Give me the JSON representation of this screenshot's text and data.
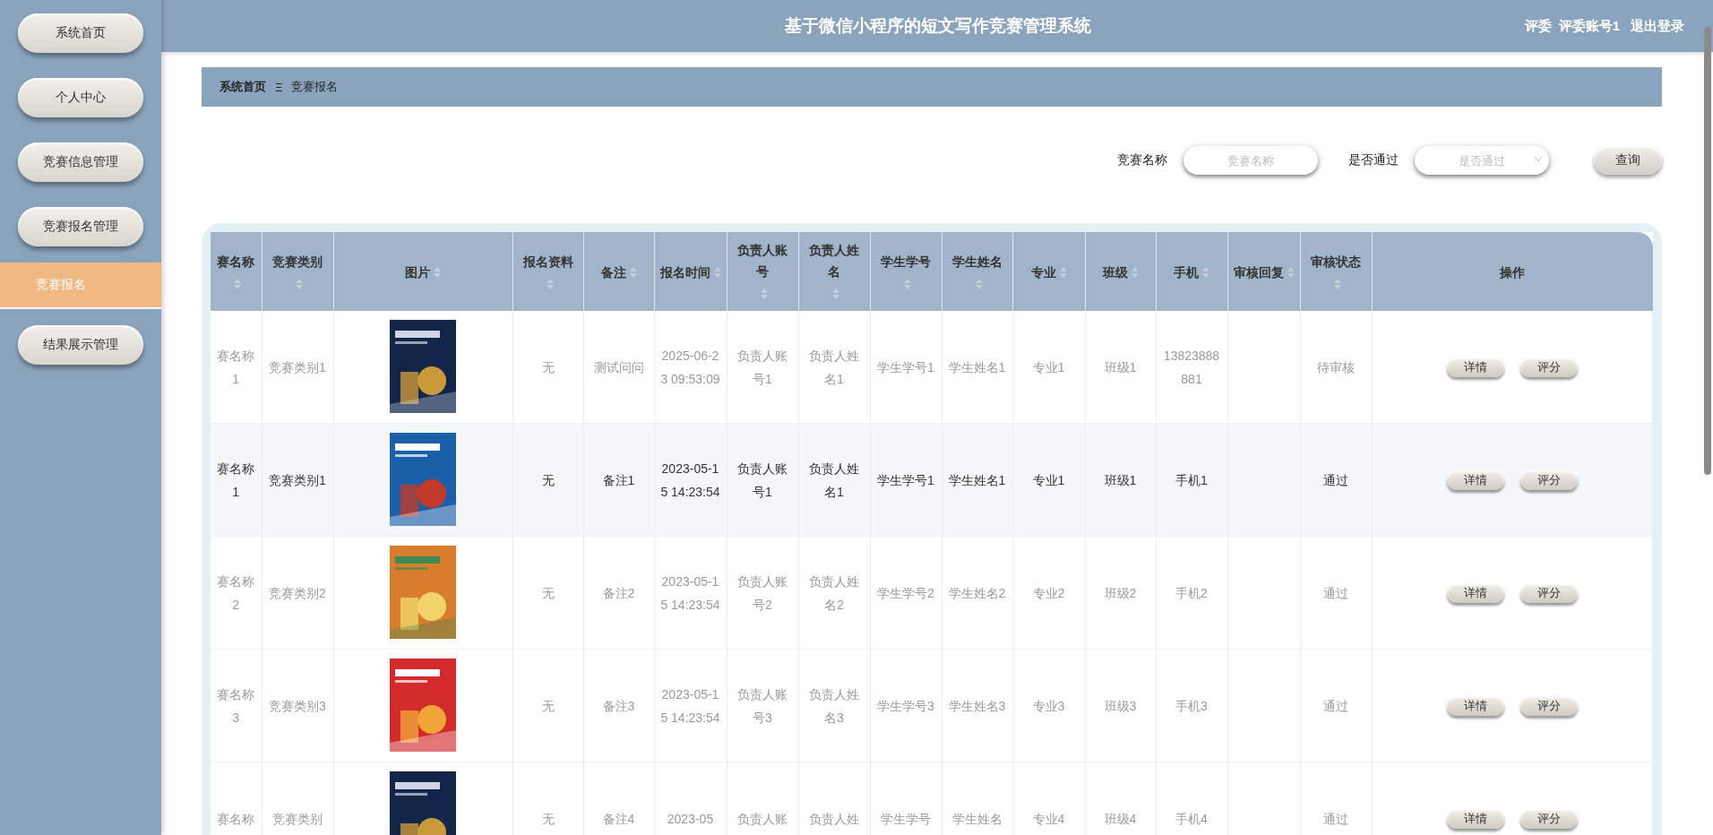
{
  "header": {
    "title": "基于微信小程序的短文写作竞赛管理系统",
    "user_role": "评委",
    "user_name": "评委账号1",
    "logout": "退出登录"
  },
  "sidebar": {
    "items": [
      {
        "label": "系统首页",
        "kind": "button",
        "selected": false
      },
      {
        "label": "个人中心",
        "kind": "button",
        "selected": false
      },
      {
        "label": "竞赛信息管理",
        "kind": "button",
        "selected": false
      },
      {
        "label": "竞赛报名管理",
        "kind": "button",
        "selected": false
      },
      {
        "label": "竞赛报名",
        "kind": "subitem",
        "selected": true
      },
      {
        "label": "结果展示管理",
        "kind": "button",
        "selected": false
      }
    ]
  },
  "breadcrumb": {
    "home": "系统首页",
    "separator": "Ξ",
    "current": "竞赛报名"
  },
  "search": {
    "fields": [
      {
        "label": "竞赛名称",
        "placeholder": "竞赛名称",
        "kind": "input"
      },
      {
        "label": "是否通过",
        "placeholder": "是否通过",
        "kind": "select"
      }
    ],
    "button": "查询"
  },
  "table": {
    "columns": [
      {
        "label": "赛名称",
        "sortable": true
      },
      {
        "label": "竞赛类别",
        "sortable": true
      },
      {
        "label": "图片",
        "sortable": true
      },
      {
        "label": "报名资料",
        "sortable": true
      },
      {
        "label": "备注",
        "sortable": true
      },
      {
        "label": "报名时间",
        "sortable": true
      },
      {
        "label": "负责人账号",
        "sortable": true
      },
      {
        "label": "负责人姓名",
        "sortable": true
      },
      {
        "label": "学生学号",
        "sortable": true
      },
      {
        "label": "学生姓名",
        "sortable": true
      },
      {
        "label": "专业",
        "sortable": true
      },
      {
        "label": "班级",
        "sortable": true
      },
      {
        "label": "手机",
        "sortable": true
      },
      {
        "label": "审核回复",
        "sortable": true
      },
      {
        "label": "审核状态",
        "sortable": true
      },
      {
        "label": "操作",
        "sortable": false
      }
    ],
    "rows": [
      {
        "highlighted": false,
        "cells": [
          {
            "kind": "text",
            "text": "赛名称1"
          },
          {
            "kind": "text",
            "text": "竞赛类别1"
          },
          {
            "kind": "picture"
          },
          {
            "kind": "text",
            "text": "无"
          },
          {
            "kind": "text",
            "text": "测试问问"
          },
          {
            "kind": "text",
            "text": "2025-06-23 09:53:09"
          },
          {
            "kind": "text",
            "text": "负责人账号1"
          },
          {
            "kind": "text",
            "text": "负责人姓名1"
          },
          {
            "kind": "text",
            "text": "学生学号1"
          },
          {
            "kind": "text",
            "text": "学生姓名1"
          },
          {
            "kind": "text",
            "text": "专业1"
          },
          {
            "kind": "text",
            "text": "班级1"
          },
          {
            "kind": "text",
            "text": "13823888881"
          },
          {
            "kind": "empty"
          },
          {
            "kind": "text",
            "text": "待审核"
          },
          {
            "kind": "actions",
            "buttons": [
              "详情",
              "评分"
            ]
          }
        ]
      },
      {
        "highlighted": true,
        "cells": [
          {
            "kind": "text",
            "text": "赛名称1"
          },
          {
            "kind": "text",
            "text": "竞赛类别1"
          },
          {
            "kind": "picture"
          },
          {
            "kind": "text",
            "text": "无"
          },
          {
            "kind": "text",
            "text": "备注1"
          },
          {
            "kind": "text",
            "text": "2023-05-15 14:23:54"
          },
          {
            "kind": "text",
            "text": "负责人账号1"
          },
          {
            "kind": "text",
            "text": "负责人姓名1"
          },
          {
            "kind": "text",
            "text": "学生学号1"
          },
          {
            "kind": "text",
            "text": "学生姓名1"
          },
          {
            "kind": "text",
            "text": "专业1"
          },
          {
            "kind": "text",
            "text": "班级1"
          },
          {
            "kind": "text",
            "text": "手机1"
          },
          {
            "kind": "empty"
          },
          {
            "kind": "text",
            "text": "通过"
          },
          {
            "kind": "actions",
            "buttons": [
              "详情",
              "评分"
            ]
          }
        ]
      },
      {
        "highlighted": false,
        "cells": [
          {
            "kind": "text",
            "text": "赛名称2"
          },
          {
            "kind": "text",
            "text": "竞赛类别2"
          },
          {
            "kind": "picture"
          },
          {
            "kind": "text",
            "text": "无"
          },
          {
            "kind": "text",
            "text": "备注2"
          },
          {
            "kind": "text",
            "text": "2023-05-15 14:23:54"
          },
          {
            "kind": "text",
            "text": "负责人账号2"
          },
          {
            "kind": "text",
            "text": "负责人姓名2"
          },
          {
            "kind": "text",
            "text": "学生学号2"
          },
          {
            "kind": "text",
            "text": "学生姓名2"
          },
          {
            "kind": "text",
            "text": "专业2"
          },
          {
            "kind": "text",
            "text": "班级2"
          },
          {
            "kind": "text",
            "text": "手机2"
          },
          {
            "kind": "empty"
          },
          {
            "kind": "text",
            "text": "通过"
          },
          {
            "kind": "actions",
            "buttons": [
              "详情",
              "评分"
            ]
          }
        ]
      },
      {
        "highlighted": false,
        "cells": [
          {
            "kind": "text",
            "text": "赛名称3"
          },
          {
            "kind": "text",
            "text": "竞赛类别3"
          },
          {
            "kind": "picture"
          },
          {
            "kind": "text",
            "text": "无"
          },
          {
            "kind": "text",
            "text": "备注3"
          },
          {
            "kind": "text",
            "text": "2023-05-15 14:23:54"
          },
          {
            "kind": "text",
            "text": "负责人账号3"
          },
          {
            "kind": "text",
            "text": "负责人姓名3"
          },
          {
            "kind": "text",
            "text": "学生学号3"
          },
          {
            "kind": "text",
            "text": "学生姓名3"
          },
          {
            "kind": "text",
            "text": "专业3"
          },
          {
            "kind": "text",
            "text": "班级3"
          },
          {
            "kind": "text",
            "text": "手机3"
          },
          {
            "kind": "empty"
          },
          {
            "kind": "text",
            "text": "通过"
          },
          {
            "kind": "actions",
            "buttons": [
              "详情",
              "评分"
            ]
          }
        ]
      },
      {
        "highlighted": false,
        "cells": [
          {
            "kind": "text",
            "text": "赛名称"
          },
          {
            "kind": "text",
            "text": "竞赛类别"
          },
          {
            "kind": "picture"
          },
          {
            "kind": "text",
            "text": "无"
          },
          {
            "kind": "text",
            "text": "备注4"
          },
          {
            "kind": "text",
            "text": "2023-05"
          },
          {
            "kind": "text",
            "text": "负责人账"
          },
          {
            "kind": "text",
            "text": "负责人姓"
          },
          {
            "kind": "text",
            "text": "学生学号"
          },
          {
            "kind": "text",
            "text": "学生姓名"
          },
          {
            "kind": "text",
            "text": "专业4"
          },
          {
            "kind": "text",
            "text": "班级4"
          },
          {
            "kind": "text",
            "text": "手机4"
          },
          {
            "kind": "empty"
          },
          {
            "kind": "text",
            "text": "通过"
          },
          {
            "kind": "actions",
            "buttons": [
              "详情",
              "评分"
            ]
          }
        ]
      }
    ]
  }
}
